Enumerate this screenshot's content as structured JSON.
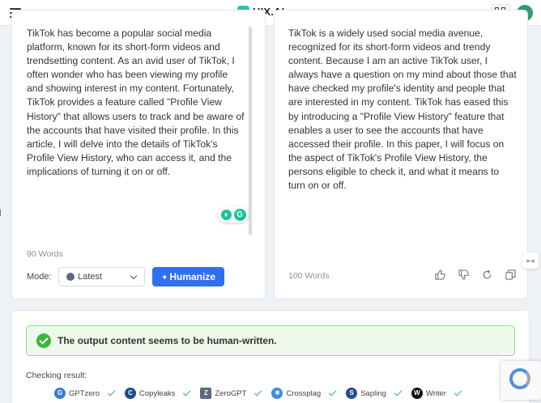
{
  "header": {
    "logo_text": "HIX.AI",
    "avatar_letter": "g",
    "icons": [
      "hamburger-icon",
      "apps-grid-icon"
    ]
  },
  "input_panel": {
    "text": "TikTok has become a popular social media platform, known for its short-form videos and trendsetting content. As an avid user of TikTok, I often wonder who has been viewing my profile and showing interest in my content. Fortunately, TikTok provides a feature called \"Profile View History\" that allows users to track and be aware of the accounts that have visited their profile. In this article, I will delve into the details of TikTok's Profile View History, who can access it, and the implications of turning it on or off.",
    "word_count": "90 Words",
    "mode_label": "Mode:",
    "mode_value": "Latest",
    "humanize_label": "Humanize"
  },
  "output_panel": {
    "text": "TikTok is a widely used social media avenue, recognized for its short-form videos and trendy content. Because I am an active TikTok user, I always have a question on my mind about those that have checked my profile's identity and people that are interested in my content. TikTok has eased this by introducing a \"Profile View History\" feature that enables a user to see the accounts that have accessed their profile. In this paper, I will focus on the aspect of TikTok's Profile View History, the persons eligible to check it, and what it means to turn on or off.",
    "word_count": "100 Words",
    "actions": [
      "thumbs-up-icon",
      "thumbs-down-icon",
      "refresh-icon",
      "copy-icon"
    ]
  },
  "result": {
    "message": "The output content seems to be human-written.",
    "checking_label": "Checking result:",
    "detectors": [
      {
        "name": "GPTzero",
        "icon_letter": "G",
        "color": "#3b7bd9"
      },
      {
        "name": "Copyleaks",
        "icon_letter": "C",
        "color": "#1b4b8f"
      },
      {
        "name": "ZeroGPT",
        "icon_letter": "Z",
        "color": "#5a6a80"
      },
      {
        "name": "Crossplag",
        "icon_letter": "✱",
        "color": "#3d8de0"
      },
      {
        "name": "Sapling",
        "icon_letter": "S",
        "color": "#2a4d8a"
      },
      {
        "name": "Writer",
        "icon_letter": "W",
        "color": "#111111"
      }
    ]
  }
}
